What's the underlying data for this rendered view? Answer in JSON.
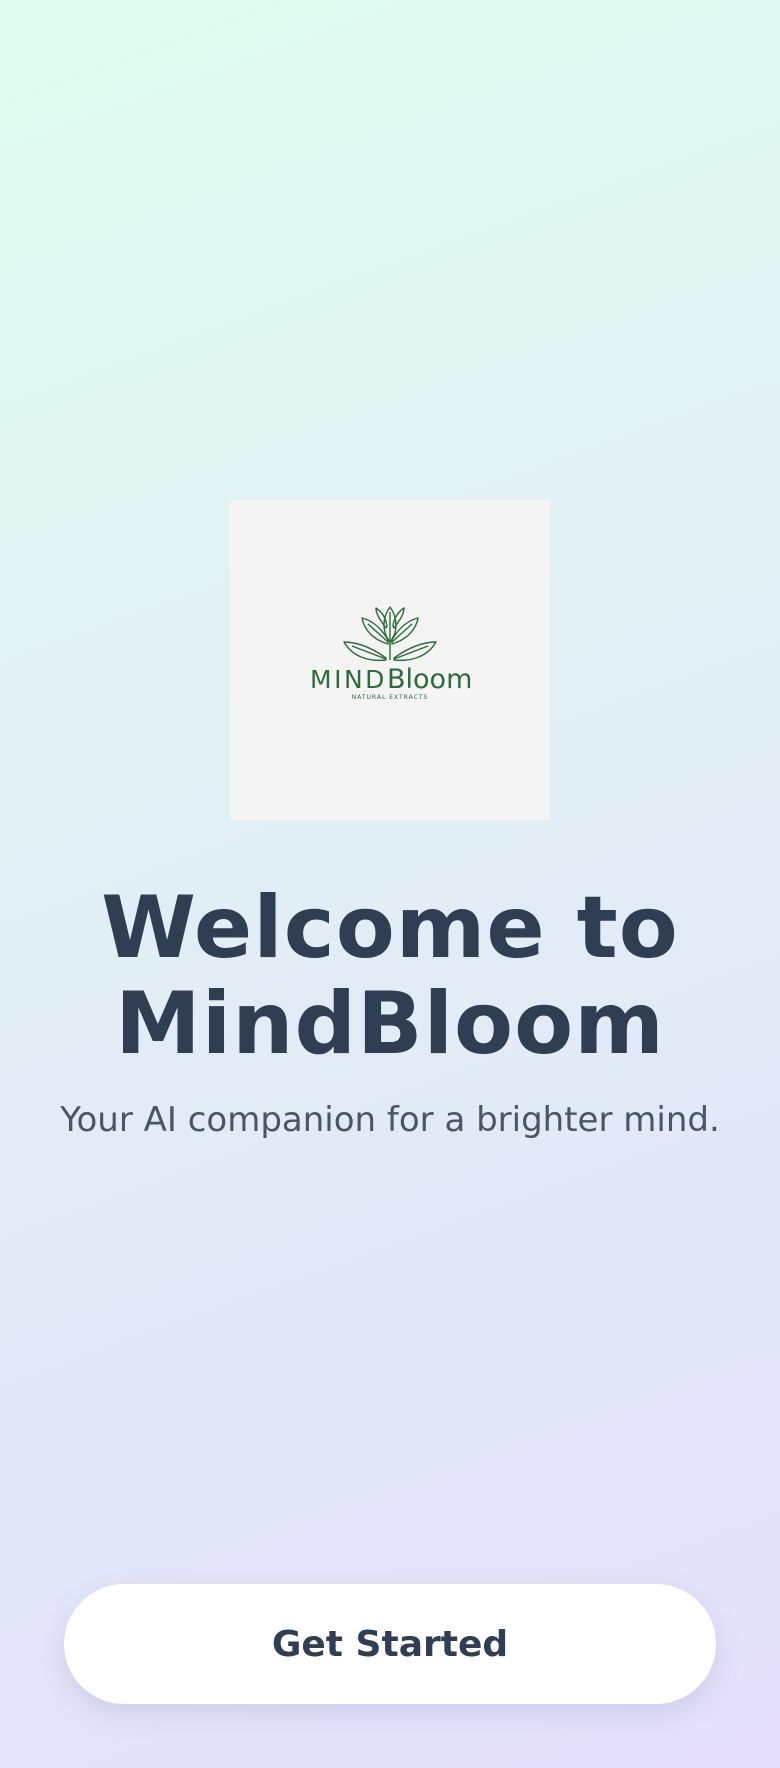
{
  "logo": {
    "icon": "leaf-sprout-icon",
    "brand_part1": "MIND",
    "brand_part2": "Bloom",
    "subtext": "NATURAL EXTRACTS",
    "color": "#2e6b3a"
  },
  "welcome": {
    "line1": "Welcome to",
    "line2": "MindBloom"
  },
  "tagline": "Your AI companion for a brighter mind.",
  "cta": {
    "label": "Get Started"
  },
  "colors": {
    "title": "#2f3e52",
    "tagline": "#4a5568",
    "button_bg": "#ffffff",
    "gradient_start": "#dffdf0",
    "gradient_end": "#e6e0fc"
  }
}
